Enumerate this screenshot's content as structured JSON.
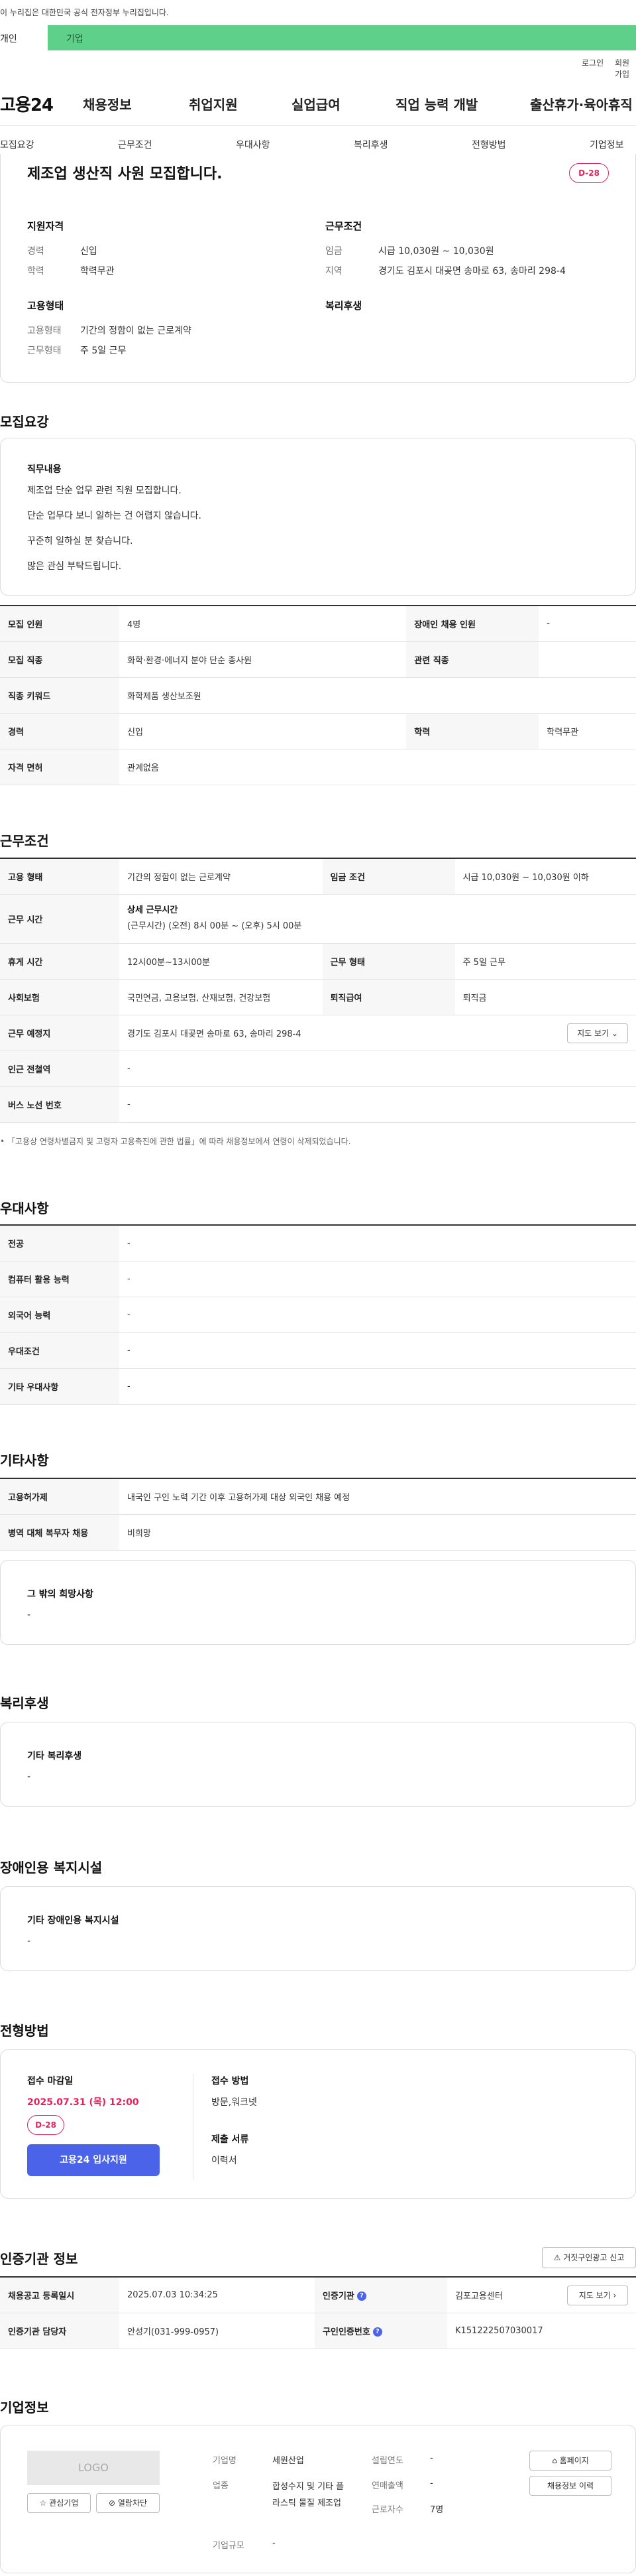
{
  "gov_banner": "이 누리집은 대한민국 공식 전자정부 누리집입니다.",
  "tabs": {
    "personal": "개인",
    "company": "기업"
  },
  "utility": {
    "login": "로그인",
    "join": "회원가입"
  },
  "brand": "고용24",
  "gnb": [
    "채용정보",
    "취업지원",
    "실업급여",
    "직업 능력 개발",
    "출산휴가·육아휴직"
  ],
  "anchors": [
    "모집요강",
    "근무조건",
    "우대사항",
    "복리후생",
    "전형방법",
    "기업정보"
  ],
  "summary": {
    "title": "제조업 생산직 사원 모집합니다.",
    "dday": "D-28",
    "qual_title": "지원자격",
    "career_label": "경력",
    "career": "신입",
    "edu_label": "학력",
    "edu": "학력무관",
    "emp_title": "고용형태",
    "emp_type_label": "고용형태",
    "emp_type": "기간의 정함이 없는 근로계약",
    "work_type_label": "근무형태",
    "work_type": "주 5일 근무",
    "cond_title": "근무조건",
    "wage_label": "임금",
    "wage": "시급 10,030원 ~ 10,030원",
    "region_label": "지역",
    "region": "경기도 김포시 대곶면 송마로 63, 송마리 298-4",
    "welfare_title": "복리후생"
  },
  "recruit": {
    "section": "모집요강",
    "duty_title": "직무내용",
    "duty_lines": [
      "제조업 단순 업무 관련 직원 모집합니다.",
      "단순 업무다 보니 일하는 건 어렵지 않습니다.",
      "꾸준히 일하실 분 찾습니다.",
      "많은 관심 부탁드립니다."
    ],
    "rows": [
      {
        "k1": "모집 인원",
        "v1": "4명",
        "k2": "장애인 채용 인원",
        "v2": "-"
      },
      {
        "k1": "모집 직종",
        "v1": "화학·환경·에너지 분야 단순 종사원",
        "k2": "관련 직종",
        "v2": ""
      },
      {
        "k1": "직종 키워드",
        "v1": "화학제품 생산보조원"
      },
      {
        "k1": "경력",
        "v1": "신입",
        "k2": "학력",
        "v2": "학력무관"
      },
      {
        "k1": "자격 면허",
        "v1": "관계없음"
      }
    ]
  },
  "work": {
    "section": "근무조건",
    "emp_label": "고용 형태",
    "emp": "기간의 정함이 없는 근로계약",
    "wage_label": "임금 조건",
    "wage": "시급 10,030원 ~ 10,030원 이하",
    "time_label": "근무 시간",
    "time_title": "상세 근무시간",
    "time": "(근무시간) (오전) 8시 00분 ~ (오후) 5시 00분",
    "break_label": "휴게 시간",
    "break": "12시00분~13시00분",
    "shift_label": "근무 형태",
    "shift": "주 5일 근무",
    "insure_label": "사회보험",
    "insure": "국민연금, 고용보험, 산재보험, 건강보험",
    "retire_label": "퇴직급여",
    "retire": "퇴직금",
    "place_label": "근무 예정지",
    "place": "경기도 김포시 대곶면 송마로 63, 송마리 298-4",
    "map_btn": "지도 보기",
    "subway_label": "인근 전철역",
    "subway": "-",
    "bus_label": "버스 노선 번호",
    "bus": "-",
    "note": "「고용상 연령차별금지 및 고령자 고용촉진에 관한 법률」에 따라 채용정보에서 연령이 삭제되었습니다."
  },
  "prefer": {
    "section": "우대사항",
    "rows": [
      {
        "k": "전공",
        "v": "-"
      },
      {
        "k": "컴퓨터 활용 능력",
        "v": "-"
      },
      {
        "k": "외국어 능력",
        "v": "-"
      },
      {
        "k": "우대조건",
        "v": "-"
      },
      {
        "k": "기타 우대사항",
        "v": "-"
      }
    ]
  },
  "etc": {
    "section": "기타사항",
    "rows": [
      {
        "k": "고용허가제",
        "v": "내국인 구인 노력 기간 이후 고용허가제 대상 외국인 채용 예정"
      },
      {
        "k": "병역 대체 복무자 채용",
        "v": "비희망"
      }
    ],
    "other_title": "그 밖의 희망사항",
    "other": "-"
  },
  "welfare": {
    "section": "복리후생",
    "title": "기타 복리후생",
    "value": "-"
  },
  "disabled": {
    "section": "장애인용 복지시설",
    "title": "기타 장애인용 복지시설",
    "value": "-"
  },
  "process": {
    "section": "전형방법",
    "deadline_title": "접수 마감일",
    "deadline": "2025.07.31 (목) 12:00",
    "dday": "D-28",
    "apply_btn": "고용24 입사지원",
    "method_title": "접수 방법",
    "method": "방문,워크넷",
    "docs_title": "제출 서류",
    "docs": "이력서"
  },
  "cert": {
    "section": "인증기관 정보",
    "report_btn": "거짓구인광고 신고",
    "reg_date_label": "채용공고 등록일시",
    "reg_date": "2025.07.03 10:34:25",
    "agency_label": "인증기관",
    "agency": "김포고용센터",
    "map_btn": "지도 보기",
    "manager_label": "인증기관 담당자",
    "manager": "안성기(031-999-0957)",
    "num_label": "구인인증번호",
    "num": "K151222507030017"
  },
  "company": {
    "section": "기업정보",
    "logo": "LOGO",
    "fav_btn": "관심기업",
    "block_btn": "열람차단",
    "name_label": "기업명",
    "name": "세원산업",
    "biz_label": "업종",
    "biz": "합성수지 및 기타 플라스틱 물질 제조업",
    "scale_label": "기업규모",
    "scale": "-",
    "founded_label": "설립연도",
    "founded": "-",
    "sales_label": "연매출액",
    "sales": "-",
    "staff_label": "근로자수",
    "staff": "7명",
    "home_btn": "홈페이지",
    "history_btn": "채용정보 이력"
  }
}
